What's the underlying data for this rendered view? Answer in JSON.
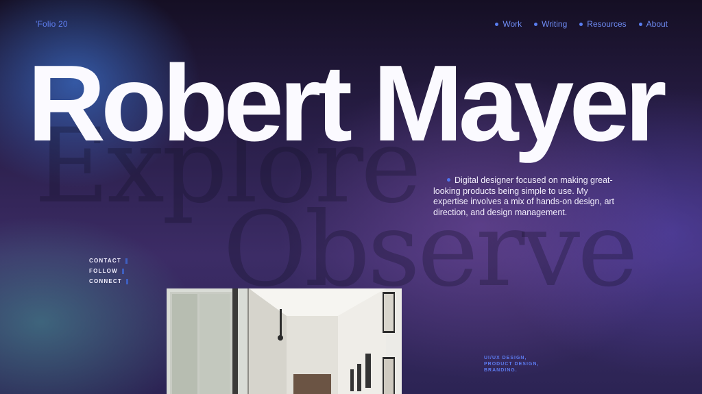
{
  "header": {
    "brand": "'Folio 20",
    "nav": [
      {
        "label": "Work"
      },
      {
        "label": "Writing"
      },
      {
        "label": "Resources"
      },
      {
        "label": "About"
      }
    ]
  },
  "hero": {
    "name": "Robert Mayer",
    "ghost_words": [
      "Explore",
      "Observe"
    ]
  },
  "intro": {
    "text": "Digital designer focused on making great-looking products being simple to use. My expertise involves a mix of hands-on design, art direction, and design management."
  },
  "social_links": [
    "CONTACT",
    "FOLLOW",
    "CONNECT"
  ],
  "services": [
    "UI/UX DESIGN,",
    "PRODUCT DESIGN,",
    "BRANDING."
  ],
  "colors": {
    "accent": "#5a7ef2",
    "text": "#fbfaff",
    "background_dark": "#150f24",
    "background_purple": "#3c2c66"
  }
}
